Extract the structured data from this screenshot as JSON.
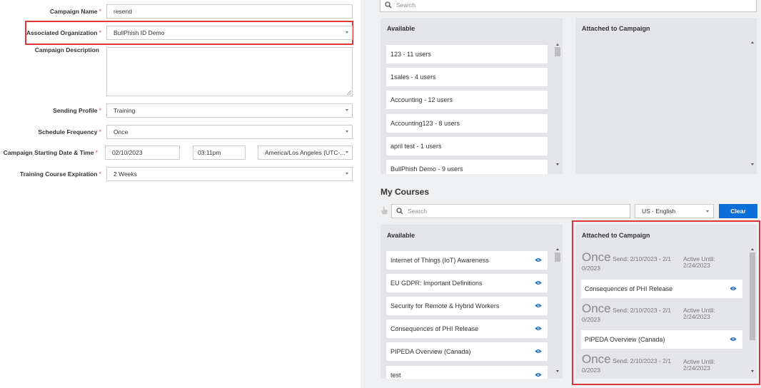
{
  "form": {
    "campaign_name": {
      "label": "Campaign Name",
      "value": "resend"
    },
    "organization": {
      "label": "Associated Organization",
      "value": "BullPhish ID Demo"
    },
    "description": {
      "label": "Campaign Description",
      "value": ""
    },
    "sending_profile": {
      "label": "Sending Profile",
      "value": "Training"
    },
    "frequency": {
      "label": "Schedule Frequency",
      "value": "Once"
    },
    "start": {
      "label": "Campaign Starting Date & Time",
      "date": "02/10/2023",
      "time": "03:11pm",
      "timezone": "America/Los Angeles (UTC-..."
    },
    "expiration": {
      "label": "Training Course Expiration",
      "value": "2 Weeks"
    },
    "required_mark": "*"
  },
  "groups": {
    "search_placeholder": "Search",
    "available_title": "Available",
    "attached_title": "Attached to Campaign",
    "available": [
      "123 - 11 users",
      "1sales - 4 users",
      "Accounting - 12 users",
      "Accounting123 - 8 users",
      "april test - 1 users",
      "BullPhish Demo - 9 users"
    ]
  },
  "courses": {
    "title": "My Courses",
    "search_placeholder": "Search",
    "language": "US - English",
    "clear_label": "Clear",
    "available_title": "Available",
    "attached_title": "Attached to Campaign",
    "available": [
      "Internet of Things (IoT) Awareness",
      "EU GDPR: Important Definitions",
      "Security for Remote & Hybrid Workers",
      "Consequences of PHI Release",
      "PIPEDA Overview (Canada)",
      "test"
    ],
    "attached": [
      {
        "frequency": "Once",
        "send": "Send: 2/10/2023 - 2/1",
        "send_wrap": "0/2023",
        "active": "Active Until:",
        "active_date": "2/24/2023",
        "course": "Consequences of PHI Release"
      },
      {
        "frequency": "Once",
        "send": "Send: 2/10/2023 - 2/1",
        "send_wrap": "0/2023",
        "active": "Active Until:",
        "active_date": "2/24/2023",
        "course": "PIPEDA Overview (Canada)"
      },
      {
        "frequency": "Once",
        "send": "Send: 2/10/2023 - 2/1",
        "send_wrap": "0/2023",
        "active": "Active Until:",
        "active_date": "2/24/2023"
      }
    ]
  },
  "colors": {
    "accent": "#0b6ed9",
    "highlight": "#e0353a",
    "required": "#d9534f"
  }
}
